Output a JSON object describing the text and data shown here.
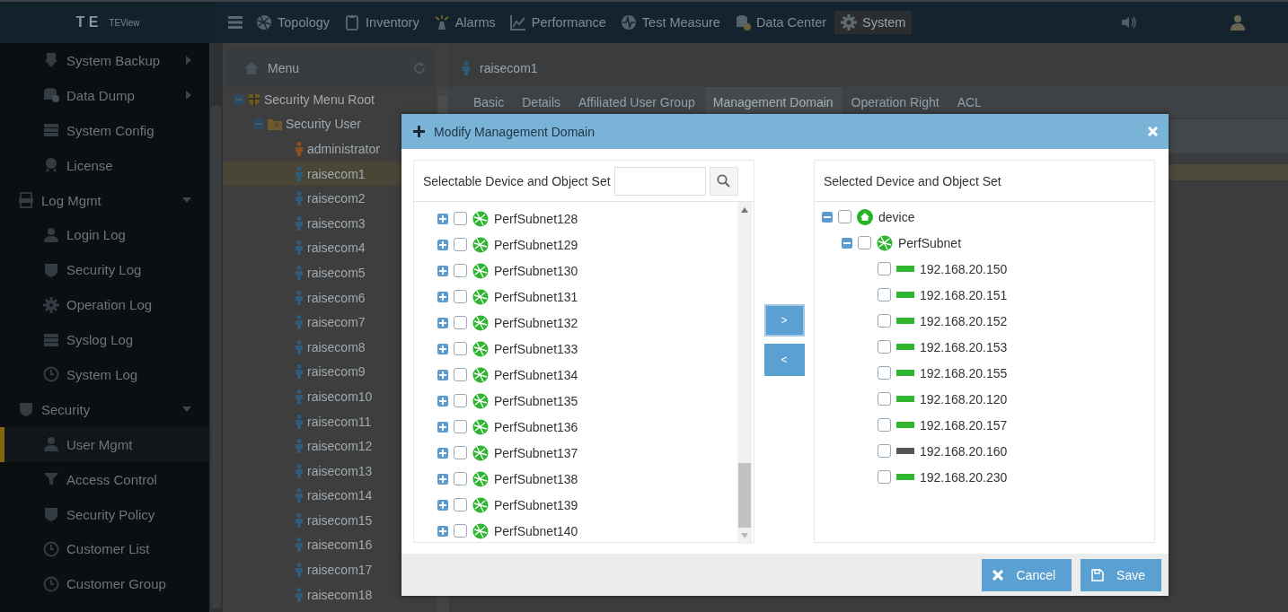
{
  "header": {
    "logo": "T E",
    "product": "TEView",
    "nav": [
      {
        "label": "Topology",
        "selected": false
      },
      {
        "label": "Inventory",
        "selected": false
      },
      {
        "label": "Alarms",
        "selected": false
      },
      {
        "label": "Performance",
        "selected": false
      },
      {
        "label": "Test Measure",
        "selected": false
      },
      {
        "label": "Data Center",
        "selected": false
      },
      {
        "label": "System",
        "selected": true
      }
    ]
  },
  "sidebar": {
    "items": [
      {
        "label": "System Backup",
        "kind": "submenu",
        "selected": false
      },
      {
        "label": "Data Dump",
        "kind": "submenu",
        "selected": false
      },
      {
        "label": "System Config",
        "kind": "link",
        "selected": false
      },
      {
        "label": "License",
        "kind": "link",
        "selected": false
      },
      {
        "label": "Log Mgmt",
        "kind": "group",
        "expanded": true,
        "children": [
          {
            "label": "Login Log",
            "kind": "link",
            "selected": false
          },
          {
            "label": "Security Log",
            "kind": "link",
            "selected": false
          },
          {
            "label": "Operation Log",
            "kind": "link",
            "selected": false
          },
          {
            "label": "Syslog Log",
            "kind": "link",
            "selected": false
          },
          {
            "label": "System Log",
            "kind": "link",
            "selected": false
          }
        ]
      },
      {
        "label": "Security",
        "kind": "group",
        "expanded": true,
        "children": [
          {
            "label": "User Mgmt",
            "kind": "link",
            "selected": true
          },
          {
            "label": "Access Control",
            "kind": "link",
            "selected": false
          },
          {
            "label": "Security Policy",
            "kind": "link",
            "selected": false
          },
          {
            "label": "Customer List",
            "kind": "link",
            "selected": false
          },
          {
            "label": "Customer Group",
            "kind": "link",
            "selected": false
          }
        ]
      }
    ]
  },
  "menu_panel": {
    "title": "Menu",
    "tree": [
      {
        "label": "Security Menu Root",
        "expanded": true,
        "children": [
          {
            "label": "Security User",
            "expanded": true,
            "children": [
              {
                "label": "administrator",
                "selected": false,
                "color": "#8a4f22"
              },
              {
                "label": "raisecom1",
                "selected": true,
                "color": "#2f5b78"
              },
              {
                "label": "raisecom2",
                "selected": false,
                "color": "#2f5b78"
              },
              {
                "label": "raisecom3",
                "selected": false,
                "color": "#2f5b78"
              },
              {
                "label": "raisecom4",
                "selected": false,
                "color": "#2f5b78"
              },
              {
                "label": "raisecom5",
                "selected": false,
                "color": "#2f5b78"
              },
              {
                "label": "raisecom6",
                "selected": false,
                "color": "#2f5b78"
              },
              {
                "label": "raisecom7",
                "selected": false,
                "color": "#2f5b78"
              },
              {
                "label": "raisecom8",
                "selected": false,
                "color": "#2f5b78"
              },
              {
                "label": "raisecom9",
                "selected": false,
                "color": "#2f5b78"
              },
              {
                "label": "raisecom10",
                "selected": false,
                "color": "#2f5b78"
              },
              {
                "label": "raisecom11",
                "selected": false,
                "color": "#2f5b78"
              },
              {
                "label": "raisecom12",
                "selected": false,
                "color": "#2f5b78"
              },
              {
                "label": "raisecom13",
                "selected": false,
                "color": "#2f5b78"
              },
              {
                "label": "raisecom14",
                "selected": false,
                "color": "#2f5b78"
              },
              {
                "label": "raisecom15",
                "selected": false,
                "color": "#2f5b78"
              },
              {
                "label": "raisecom16",
                "selected": false,
                "color": "#2f5b78"
              },
              {
                "label": "raisecom17",
                "selected": false,
                "color": "#2f5b78"
              },
              {
                "label": "raisecom18",
                "selected": false,
                "color": "#2f5b78"
              }
            ]
          }
        ]
      }
    ]
  },
  "detail": {
    "title": "raisecom1",
    "tabs": [
      {
        "label": "Basic",
        "selected": false
      },
      {
        "label": "Details",
        "selected": false
      },
      {
        "label": "Affiliated User Group",
        "selected": false
      },
      {
        "label": "Management Domain",
        "selected": true
      },
      {
        "label": "Operation Right",
        "selected": false
      },
      {
        "label": "ACL",
        "selected": false
      }
    ]
  },
  "dialog": {
    "title": "Modify Management Domain",
    "selectable": {
      "title": "Selectable Device and Object Set",
      "items": [
        {
          "label": "PerfSubnet128",
          "expanded": false,
          "checked": false
        },
        {
          "label": "PerfSubnet129",
          "expanded": false,
          "checked": false
        },
        {
          "label": "PerfSubnet130",
          "expanded": false,
          "checked": false
        },
        {
          "label": "PerfSubnet131",
          "expanded": false,
          "checked": false
        },
        {
          "label": "PerfSubnet132",
          "expanded": false,
          "checked": false
        },
        {
          "label": "PerfSubnet133",
          "expanded": false,
          "checked": false
        },
        {
          "label": "PerfSubnet134",
          "expanded": false,
          "checked": false
        },
        {
          "label": "PerfSubnet135",
          "expanded": false,
          "checked": false
        },
        {
          "label": "PerfSubnet136",
          "expanded": false,
          "checked": false
        },
        {
          "label": "PerfSubnet137",
          "expanded": false,
          "checked": false
        },
        {
          "label": "PerfSubnet138",
          "expanded": false,
          "checked": false
        },
        {
          "label": "PerfSubnet139",
          "expanded": false,
          "checked": false
        },
        {
          "label": "PerfSubnet140",
          "expanded": false,
          "checked": false
        }
      ]
    },
    "move_buttons": [
      ">",
      "<"
    ],
    "selected_set": {
      "title": "Selected Device and Object Set",
      "tree": [
        {
          "label": "device",
          "kind": "root",
          "expanded": true,
          "checked": false,
          "children": [
            {
              "label": "PerfSubnet",
              "kind": "subnet",
              "expanded": true,
              "checked": false,
              "children": [
                {
                  "label": "192.168.20.150",
                  "kind": "device",
                  "checked": false,
                  "color": "#2fb52f"
                },
                {
                  "label": "192.168.20.151",
                  "kind": "device",
                  "checked": false,
                  "color": "#2fb52f"
                },
                {
                  "label": "192.168.20.152",
                  "kind": "device",
                  "checked": false,
                  "color": "#2fb52f"
                },
                {
                  "label": "192.168.20.153",
                  "kind": "device",
                  "checked": false,
                  "color": "#2fb52f"
                },
                {
                  "label": "192.168.20.155",
                  "kind": "device",
                  "checked": false,
                  "color": "#2fb52f"
                },
                {
                  "label": "192.168.20.120",
                  "kind": "device",
                  "checked": false,
                  "color": "#2fb52f"
                },
                {
                  "label": "192.168.20.157",
                  "kind": "device",
                  "checked": false,
                  "color": "#2fb52f"
                },
                {
                  "label": "192.168.20.160",
                  "kind": "device",
                  "checked": false,
                  "color": "#555555"
                },
                {
                  "label": "192.168.20.230",
                  "kind": "device",
                  "checked": false,
                  "color": "#2fb52f"
                }
              ]
            }
          ]
        }
      ]
    },
    "buttons": [
      {
        "label": "Cancel",
        "kind": "cancel"
      },
      {
        "label": "Save",
        "kind": "save"
      }
    ]
  }
}
